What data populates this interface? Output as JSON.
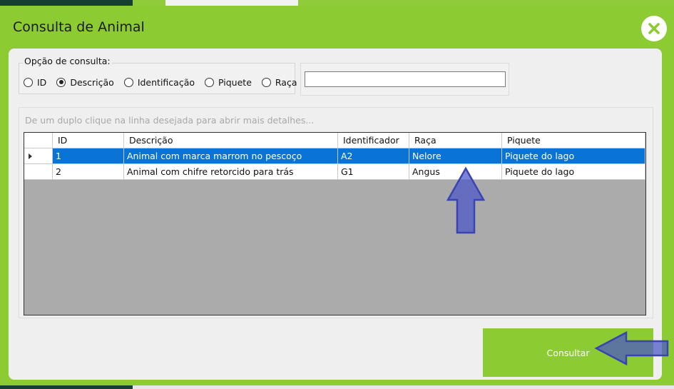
{
  "dialog": {
    "title": "Consulta de Animal",
    "close_icon": "close-icon",
    "accent_color": "#8dcb33"
  },
  "search_options": {
    "legend": "Opção de consulta:",
    "options": [
      {
        "label": "ID",
        "selected": false
      },
      {
        "label": "Descrição",
        "selected": true
      },
      {
        "label": "Identificação",
        "selected": false
      },
      {
        "label": "Piquete",
        "selected": false
      },
      {
        "label": "Raça",
        "selected": false
      }
    ]
  },
  "search_input": {
    "value": ""
  },
  "results": {
    "hint": "De um duplo clique na linha desejada para abrir mais detalhes...",
    "columns": [
      "ID",
      "Descrição",
      "Identificador",
      "Raça",
      "Piquete"
    ],
    "rows": [
      {
        "id": "1",
        "descricao": "Animal com marca marrom no pescoço",
        "identificador": "A2",
        "raca": "Nelore",
        "piquete": "Piquete do lago",
        "selected": true
      },
      {
        "id": "2",
        "descricao": "Animal com chifre retorcido para trás",
        "identificador": "G1",
        "raca": "Angus",
        "piquete": "Piquete do lago",
        "selected": false
      }
    ],
    "selection_color": "#0a74d6"
  },
  "actions": {
    "consult_label": "Consultar"
  },
  "annotations": {
    "arrow_color": "#4a55c8",
    "arrows": [
      "up-arrow-icon",
      "left-arrow-icon"
    ]
  }
}
